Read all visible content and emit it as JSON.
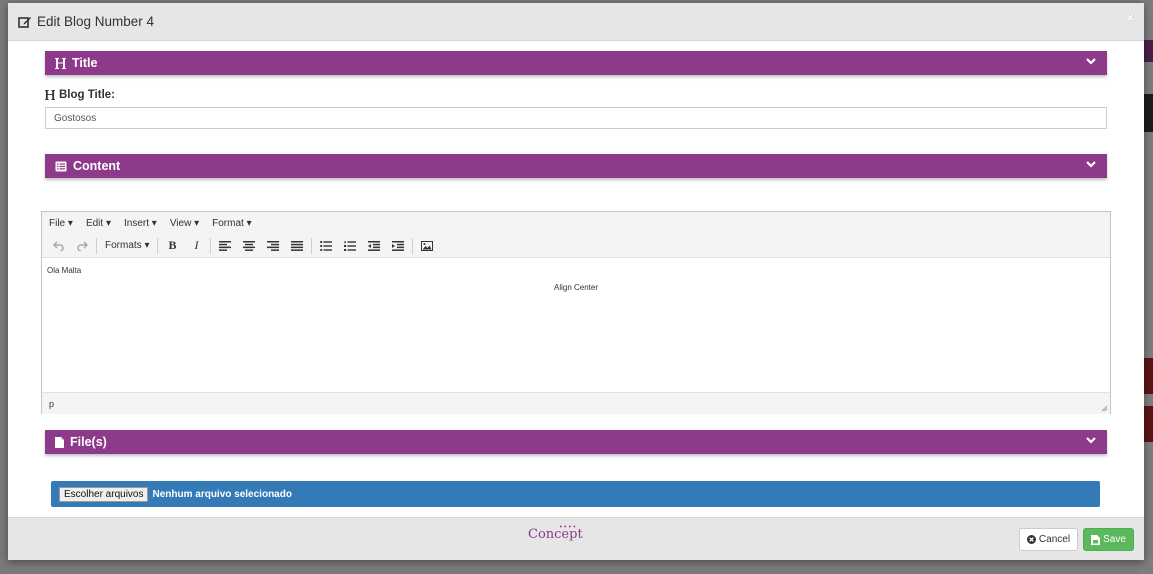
{
  "modal": {
    "title": "Edit Blog Number 4",
    "close_symbol": "×"
  },
  "sections": {
    "title_label": "Title",
    "content_label": "Content",
    "files_label": "File(s)"
  },
  "blog_title_field": {
    "label": "Blog Title:",
    "value": "Gostosos"
  },
  "editor": {
    "menus": [
      "File",
      "Edit",
      "Insert",
      "View",
      "Format"
    ],
    "formats_label": "Formats",
    "paragraph_1": "Ola Malta",
    "paragraph_2": "Align Center",
    "status_path": "p"
  },
  "file_input": {
    "button_label": "Escolher arquivos",
    "status": "Nenhum arquivo selecionado"
  },
  "footer": {
    "logo_text": "Concept",
    "cancel_label": "Cancel",
    "save_label": "Save"
  },
  "colors": {
    "section_bar": "#8e3a8b",
    "file_bar": "#337ab7",
    "save_button": "#5cb85c"
  },
  "icons": {
    "modal_title": "edit-icon",
    "title_section": "heading-icon",
    "content_section": "list-alt-icon",
    "files_section": "file-icon",
    "section_toggle": "chevron-down-icon",
    "cancel": "times-circle-icon",
    "save": "save-icon"
  }
}
